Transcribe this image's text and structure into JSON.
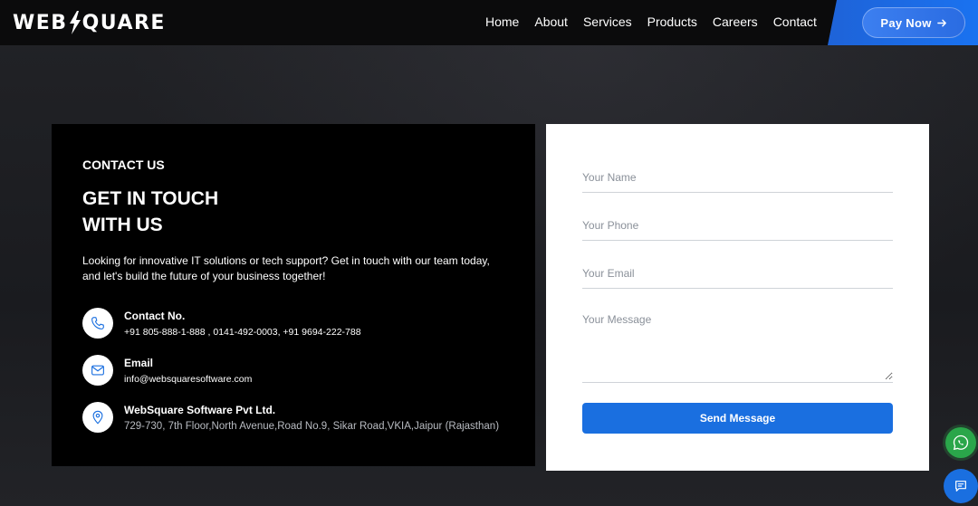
{
  "header": {
    "logo_left": "WEB",
    "logo_right": "QUARE",
    "nav": [
      "Home",
      "About",
      "Services",
      "Products",
      "Careers",
      "Contact"
    ],
    "pay_button": "Pay Now"
  },
  "contact": {
    "eyebrow": "CONTACT US",
    "headline_line1": "GET IN TOUCH",
    "headline_line2": "WITH US",
    "intro": "Looking for innovative IT solutions or tech support? Get in touch with our team today, and let's build the future of your business together!",
    "phone_title": "Contact No.",
    "phone_value": "+91 805-888-1-888 , 0141-492-0003, +91 9694-222-788",
    "email_title": "Email",
    "email_value": "info@websquaresoftware.com",
    "address_title": "WebSquare Software Pvt Ltd.",
    "address_value": "729-730, 7th Floor,North Avenue,Road No.9, Sikar Road,VKIA,Jaipur (Rajasthan)"
  },
  "form": {
    "name_placeholder": "Your Name",
    "phone_placeholder": "Your Phone",
    "email_placeholder": "Your Email",
    "message_placeholder": "Your Message",
    "submit": "Send Message"
  },
  "colors": {
    "accent": "#1a6fe0",
    "whatsapp": "#2aa64a"
  },
  "icons": [
    "phone-icon",
    "mail-icon",
    "location-icon",
    "arrow-right-icon",
    "whatsapp-icon",
    "chat-icon"
  ]
}
